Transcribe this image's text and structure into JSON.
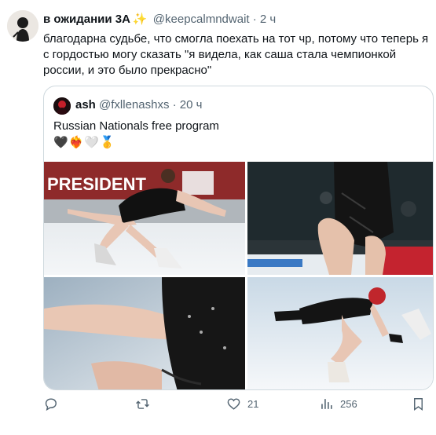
{
  "tweet": {
    "author_name": "в ожидании 3А",
    "author_emoji": "✨",
    "handle": "@keepcalmndwait",
    "time": "· 2 ч",
    "text": "благодарна судьбе, что смогла поехать на тот чр, потому что теперь я с гордостью могу сказать \"я видела, как саша стала чемпионкой россии, и это было прекрасно\""
  },
  "quote": {
    "author_name": "ash",
    "handle": "@fxllenashxs",
    "time": "· 20 ч",
    "text": "Russian Nationals free program",
    "emoji": "🖤❤️‍🔥🤍🥇",
    "photos": [
      "skater-spiral-photo",
      "skater-closeup-photo",
      "skater-dress-detail-photo",
      "skater-sitspin-photo"
    ],
    "photo_banner_text": "PRESIDENT"
  },
  "actions": {
    "reply_count": "",
    "retweet_count": "",
    "like_count": "21",
    "views_count": "256"
  }
}
